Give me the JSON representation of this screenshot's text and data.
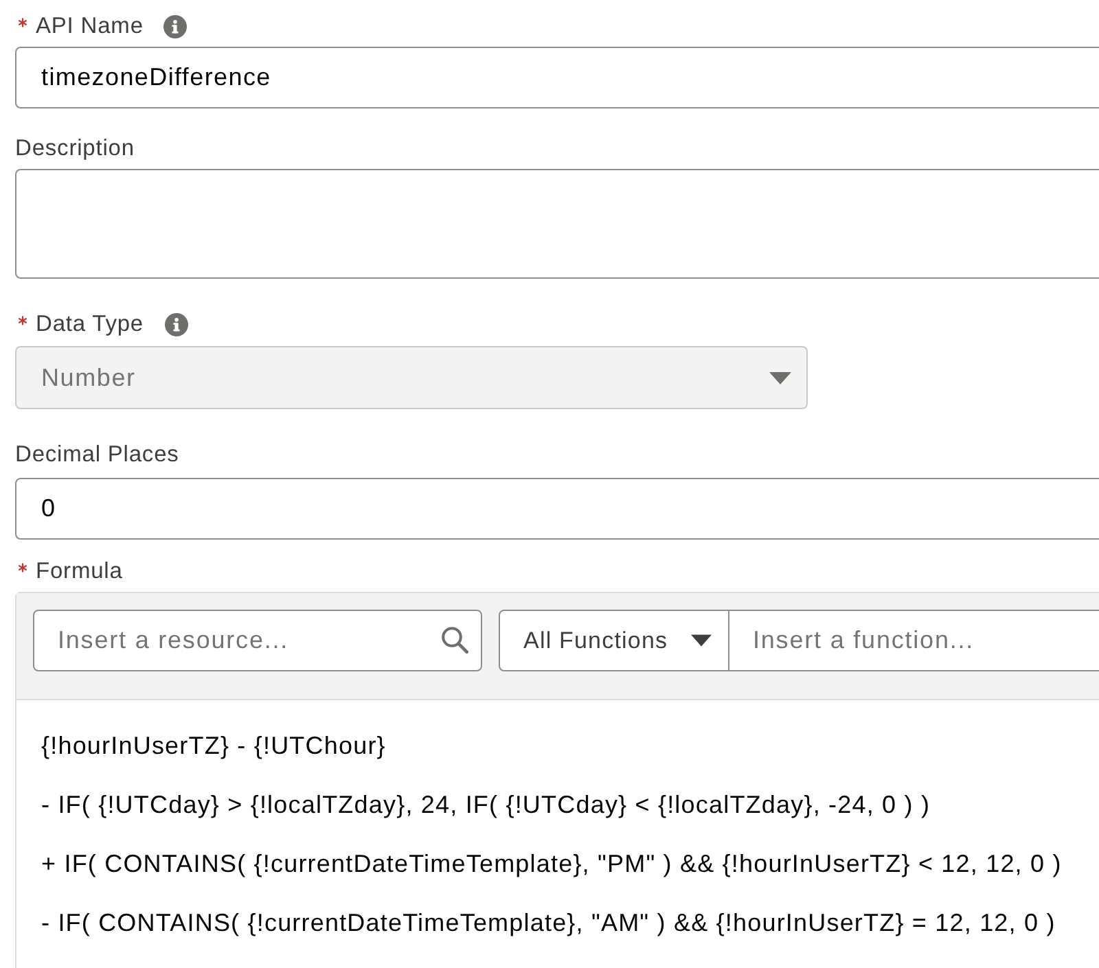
{
  "fields": [
    {
      "kind": "text",
      "label": "API Name",
      "required": true,
      "info": true,
      "value": "timezoneDifference"
    },
    {
      "kind": "textarea",
      "label": "Description",
      "required": false,
      "info": false
    },
    {
      "kind": "select",
      "label": "Data Type",
      "required": true,
      "info": true,
      "value": "Number",
      "disabled": true
    },
    {
      "kind": "text",
      "label": "Decimal Places",
      "required": false,
      "info": false,
      "value": "0"
    },
    {
      "kind": "formula",
      "label": "Formula",
      "required": true,
      "info": false,
      "resource_search": {
        "placeholder": "Insert a resource..."
      },
      "function_category": {
        "value": "All Functions"
      },
      "function_search": {
        "placeholder": "Insert a function..."
      },
      "lines": [
        "{!hourInUserTZ} - {!UTChour}",
        "- IF( {!UTCday} > {!localTZday}, 24, IF( {!UTCday} < {!localTZday}, -24, 0 ) )",
        "+ IF( CONTAINS( {!currentDateTimeTemplate}, \"PM\" ) && {!hourInUserTZ} < 12, 12, 0 )",
        "- IF( CONTAINS( {!currentDateTimeTemplate}, \"AM\" ) && {!hourInUserTZ} = 12, 12, 0 )"
      ]
    }
  ]
}
